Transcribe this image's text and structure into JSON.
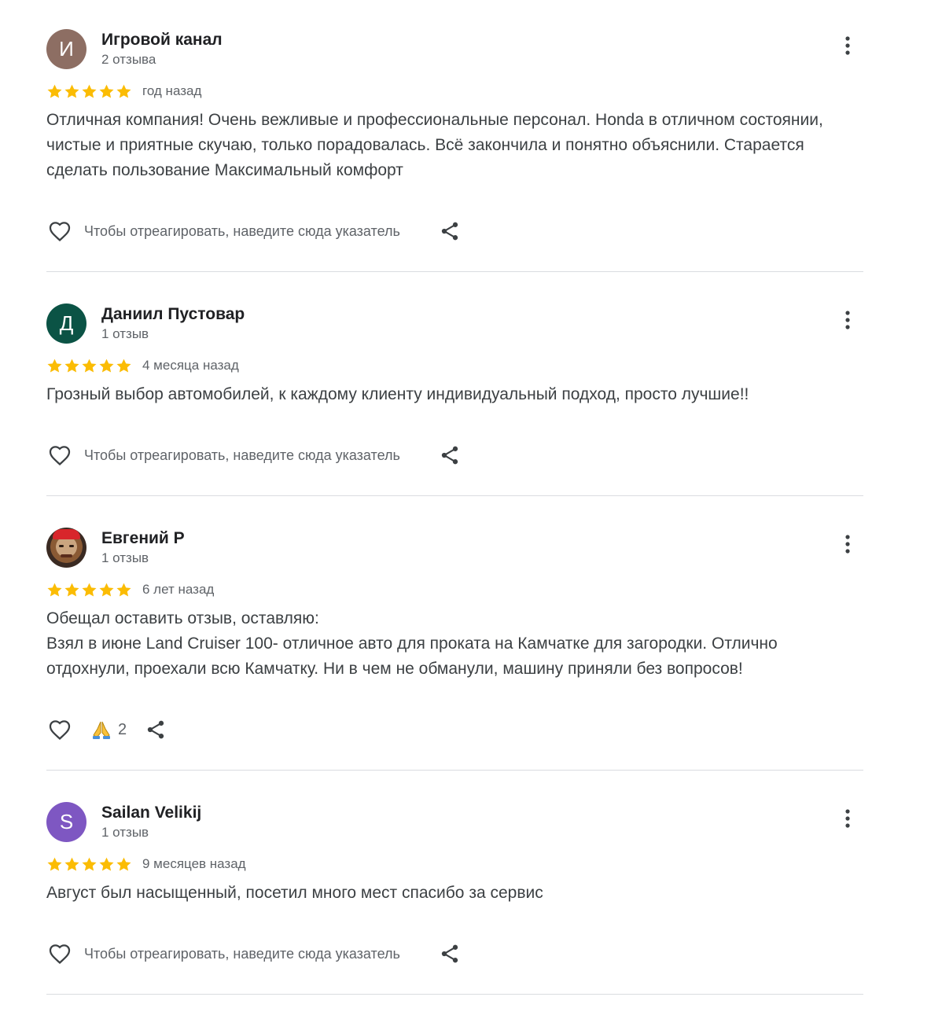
{
  "colors": {
    "star": "#fbbc04",
    "separator": "#dadce0",
    "name": "#202124",
    "meta": "#5f6368",
    "text": "#3c4043"
  },
  "reviews": [
    {
      "avatar_letter": "И",
      "avatar_color": "#8d6e63",
      "name": "Игровой канал",
      "meta": "2 отзыва",
      "stars": 5,
      "date": "год назад",
      "text": "Отличная компания! Очень вежливые и профессиональные персонал. Honda в отличном состоянии, чистые и приятные скучаю, только порадовалась. Всё закончила и понятно объяснили. Старается сделать пользование Максимальный комфорт",
      "hint": "Чтобы отреагировать, наведите сюда указатель"
    },
    {
      "avatar_letter": "Д",
      "avatar_color": "#0b5345",
      "name": "Даниил Пустовар",
      "meta": "1 отзыв",
      "stars": 5,
      "date": "4 месяца назад",
      "text": "Грозный выбор автомобилей, к каждому клиенту индивидуальный подход, просто лучшие!!",
      "hint": "Чтобы отреагировать, наведите сюда указатель"
    },
    {
      "avatar_letter": "",
      "avatar_color": "#6d4c41",
      "name": "Евгений Р",
      "meta": "1 отзыв",
      "stars": 5,
      "date": "6 лет назад",
      "text": "Обещал оставить отзыв, оставляю:\nВзял в июне Land Cruiser 100- отличное авто для проката на Камчатке для загородки. Отлично отдохнули, проехали всю Камчатку. Ни в чем не обманули, машину приняли без вопросов!",
      "reaction_icon": "folded-hands-emoji",
      "reaction_count": "2"
    },
    {
      "avatar_letter": "S",
      "avatar_color": "#7e57c2",
      "name": "Sailan Velikij",
      "meta": "1 отзыв",
      "stars": 5,
      "date": "9 месяцев назад",
      "text": "Август был насыщенный, посетил много мест спасибо за сервис",
      "hint": "Чтобы отреагировать, наведите сюда указатель"
    }
  ]
}
